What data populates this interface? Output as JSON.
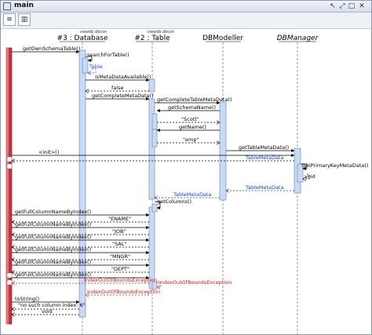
{
  "window": {
    "title": "main",
    "controls": [
      "↖",
      "⤢",
      "□",
      "✕"
    ]
  },
  "toolbar": {
    "buttons": [
      "≡",
      "▥"
    ]
  },
  "lifelines": [
    {
      "package": "viewdb.dbcon",
      "name": "#3 : Database",
      "italic": false
    },
    {
      "package": "viewdb.dbcon",
      "name": "#2 : Table",
      "italic": false
    },
    {
      "package": "",
      "name": "DBModeller",
      "italic": false
    },
    {
      "package": "",
      "name": "DBManager",
      "italic": true
    }
  ],
  "messages": [
    "getOwnSchemaTable()",
    "searchForTable()",
    "Table",
    "isMetaDataAvailable()",
    "false",
    "getCompleteMetaData()",
    "getCompleteTableMetaData()",
    "getSchemaName()",
    "\"Scott\"",
    "getName()",
    "\"emp\"",
    "getTableMetaData()",
    "<init>()",
    "TableMetaData",
    "getPrimaryKeyMetaData()",
    "void",
    "TableMetaData",
    "TableMetaData",
    "getColumns()",
    "getFullColumnNameByIndex()",
    "\"ENAME\"",
    "getFullColumnNameByIndex()",
    "\"JOB\"",
    "getFullColumnNameByIndex()",
    "\"SAL\"",
    "getFullColumnNameByIndex()",
    "\"MNGR\"",
    "getFullColumnNameByIndex()",
    "\"DEPT\"",
    "getFullColumnNameByIndex()",
    "IndexOutOfBoundsException",
    "IndexOutOfBoundsException",
    "IndexOutOfBoundsException",
    "toString()",
    "\"no such column index: 6\"",
    "void"
  ],
  "colors": {
    "call": "#000000",
    "return": "#000000",
    "blue": "#1a3fcf",
    "exception": "#d21a1a",
    "activation": "#c9daf5",
    "actor_bar": "#c8323c"
  }
}
